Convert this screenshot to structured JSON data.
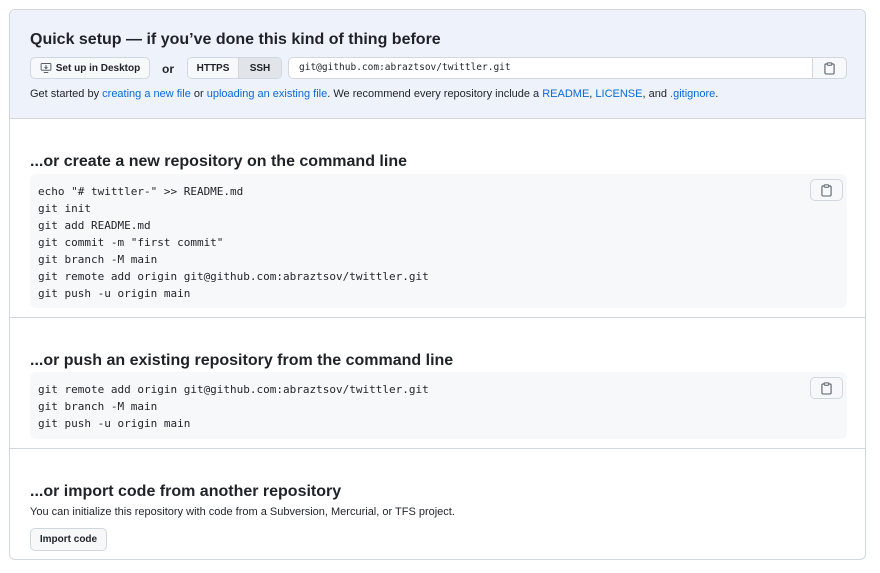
{
  "quick_setup": {
    "heading": "Quick setup — if you’ve done this kind of thing before",
    "desktop_button": "Set up in Desktop",
    "or_label": "or",
    "protocol": {
      "https": "HTTPS",
      "ssh": "SSH",
      "selected": "SSH"
    },
    "clone_url": "git@github.com:abraztsov/twittler.git",
    "get_started": {
      "t1": "Get started by ",
      "link_new_file": "creating a new file",
      "t2": " or ",
      "link_upload": "uploading an existing file",
      "t3": ". We recommend every repository include a ",
      "link_readme": "README",
      "t4": ", ",
      "link_license": "LICENSE",
      "t5": ", and ",
      "link_gitignore": ".gitignore",
      "t6": "."
    }
  },
  "new_repo": {
    "heading": "...or create a new repository on the command line",
    "lines": [
      "echo \"# twittler-\" >> README.md",
      "git init",
      "git add README.md",
      "git commit -m \"first commit\"",
      "git branch -M main",
      "git remote add origin git@github.com:abraztsov/twittler.git",
      "git push -u origin main"
    ]
  },
  "push_existing": {
    "heading": "...or push an existing repository from the command line",
    "lines": [
      "git remote add origin git@github.com:abraztsov/twittler.git",
      "git branch -M main",
      "git push -u origin main"
    ]
  },
  "import": {
    "heading": "...or import code from another repository",
    "description": "You can initialize this repository with code from a Subversion, Mercurial, or TFS project.",
    "button": "Import code"
  },
  "icons": {
    "desktop": "desktop-download-icon",
    "copy": "clipboard-copy-icon"
  },
  "colors": {
    "link": "#0969da",
    "quick_bg": "#eef3fb",
    "code_bg": "#f6f8fa",
    "border": "#d0d7de"
  }
}
